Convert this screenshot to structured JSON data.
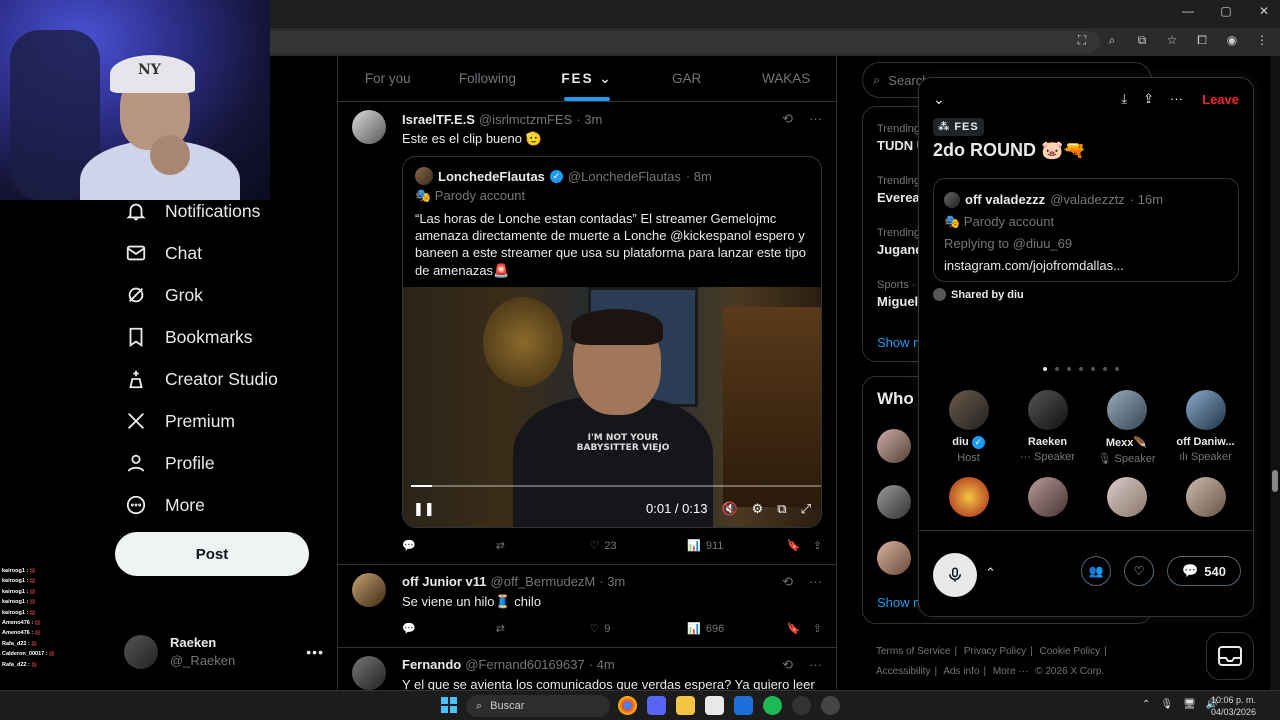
{
  "browser": {
    "window_controls": [
      "—",
      "▢",
      "✕"
    ]
  },
  "stream_chat": [
    {
      "user": "kairoog1 :",
      "msg": ""
    },
    {
      "user": "kairoog1 :",
      "msg": ""
    },
    {
      "user": "kairoog1 :",
      "msg": ""
    },
    {
      "user": "kairoog1 :",
      "msg": ""
    },
    {
      "user": "kairoog1 :",
      "msg": ""
    },
    {
      "user": "Ameno476 :",
      "msg": ""
    },
    {
      "user": "Ameno476 :",
      "msg": ""
    },
    {
      "user": "Rafa_d22 :",
      "msg": ""
    },
    {
      "user": "Calderon_00017 :",
      "msg": ""
    },
    {
      "user": "Rafa_d22 :",
      "msg": ""
    }
  ],
  "nav": {
    "items": [
      {
        "label": "Notifications",
        "icon": "bell-icon"
      },
      {
        "label": "Chat",
        "icon": "mail-icon"
      },
      {
        "label": "Grok",
        "icon": "grok-icon"
      },
      {
        "label": "Bookmarks",
        "icon": "bookmark-icon"
      },
      {
        "label": "Creator Studio",
        "icon": "creator-studio-icon"
      },
      {
        "label": "Premium",
        "icon": "x-logo-icon"
      },
      {
        "label": "Profile",
        "icon": "person-icon"
      },
      {
        "label": "More",
        "icon": "more-circle-icon"
      }
    ],
    "post_label": "Post",
    "account": {
      "name": "Raeken",
      "handle": "@_Raeken"
    }
  },
  "tabs": [
    "For you",
    "Following",
    "FES",
    "GAR",
    "WAKAS"
  ],
  "tweets": [
    {
      "name": "IsraelTF.E.S",
      "handle": "@isrlmctzmFES",
      "time": "· 3m",
      "text": "Este es el clip bueno 🫡",
      "quote": {
        "name": "LonchedeFlautas",
        "handle": "@LonchedeFlautas",
        "time": "· 8m",
        "parody": "🎭 Parody account",
        "text": "“Las horas de Lonche estan contadas” El streamer Gemelojmc amenaza directamente de muerte a Lonche @kickespanol espero y baneen a este streamer que usa su plataforma para lanzar este tipo de amenazas🚨",
        "video": {
          "shirt_text": "I'M NOT YOUR BABYSITTER VIEJO",
          "time": "0:01 / 0:13",
          "progress": 0.05
        }
      },
      "stats": {
        "replies": "",
        "reposts": "",
        "likes": "23",
        "views": "911"
      }
    },
    {
      "name": "off Junior v11",
      "handle": "@off_BermudezM",
      "time": "· 3m",
      "text": "Se viene un hilo🧵 chilo",
      "stats": {
        "replies": "",
        "reposts": "",
        "likes": "9",
        "views": "696"
      }
    },
    {
      "name": "Fernando",
      "handle": "@Fernand60169637",
      "time": "· 4m",
      "text": "Y el que se avienta los comunicados que verdas espera? Ya quiero leer “LA"
    }
  ],
  "right": {
    "search_placeholder": "Search",
    "trends": [
      {
        "label": "Trending",
        "name": "TUDN U"
      },
      {
        "label": "Trending",
        "name": "Evereac"
      },
      {
        "label": "Trending",
        "name": "Jugando"
      },
      {
        "label": "Sports · ",
        "name": "Miguel"
      }
    ],
    "show_more": "Show m",
    "who_title": "Who t",
    "who_show_more": "Show m",
    "footer": [
      "Terms of Service",
      "|",
      "Privacy Policy",
      "|",
      "Cookie Policy",
      "|",
      "Accessibility",
      "|",
      "Ads info",
      "|",
      "More ···",
      "© 2026 X Corp."
    ]
  },
  "space": {
    "leave": "Leave",
    "badge": "FES",
    "title": "2do ROUND 🐷🔫",
    "shared_post": {
      "name": "off valadezzz",
      "handle": "@valadezztz",
      "time": "· 16m",
      "parody": "🎭 Parody account",
      "replying": "Replying to @diuu_69",
      "link": "instagram.com/jojofromdallas..."
    },
    "shared_by": "Shared by diu",
    "page_dots": 7,
    "active_dot": 0,
    "speakers": [
      {
        "name": "diu",
        "verified": true,
        "role": "Host"
      },
      {
        "name": "Raeken",
        "role": "··· Speaker"
      },
      {
        "name": "Mexx🪶",
        "role": "🎙 Speaker"
      },
      {
        "name": "off Daniw...",
        "role": "ılı Speaker"
      },
      {
        "name": "",
        "role": ""
      },
      {
        "name": "",
        "role": ""
      },
      {
        "name": "",
        "role": ""
      },
      {
        "name": "",
        "role": ""
      }
    ],
    "listeners_count": "540"
  },
  "taskbar": {
    "search": "Buscar",
    "time": "10:06 p. m.",
    "date": "04/03/2026"
  }
}
